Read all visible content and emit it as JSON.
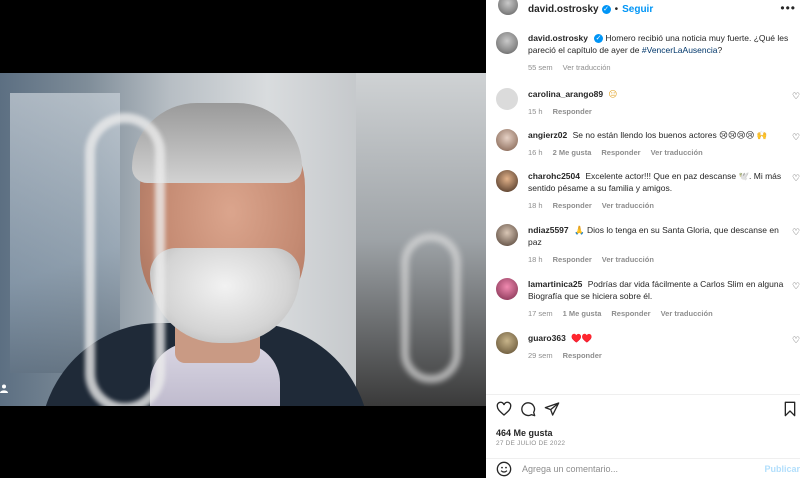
{
  "post": {
    "author": "david.ostrosky",
    "follow_label": "Seguir",
    "more_icon": "more-horizontal-icon"
  },
  "caption": {
    "username": "david.ostrosky",
    "text": "Homero recibió una noticia muy fuerte. ¿Qué les pareció el capítulo de ayer de ",
    "hashtag": "#VencerLaAusencia",
    "text_end": "?",
    "time": "55 sem",
    "see_translation": "Ver traducción"
  },
  "comments": [
    {
      "username": "carolina_arango89",
      "text": "😐",
      "time": "15 h",
      "likes": "",
      "reply": "Responder",
      "see_translation": ""
    },
    {
      "username": "angierz02",
      "text": "Se no están llendo los buenos actores 😢😢😢😢 🙌",
      "time": "16 h",
      "likes": "2 Me gusta",
      "reply": "Responder",
      "see_translation": "Ver traducción"
    },
    {
      "username": "charohc2504",
      "text": "Excelente actor!!! Que en paz descanse 🕊️. Mi más sentido pésame a su familia y amigos.",
      "time": "18 h",
      "likes": "",
      "reply": "Responder",
      "see_translation": "Ver traducción"
    },
    {
      "username": "ndiaz5597",
      "text": "🙏 Dios lo tenga en su Santa Gloria, que descanse en paz",
      "time": "18 h",
      "likes": "",
      "reply": "Responder",
      "see_translation": "Ver traducción"
    },
    {
      "username": "lamartinica25",
      "text": "Podrías dar vida fácilmente a Carlos Slim en alguna Biografía que se hiciera sobre él.",
      "time": "17 sem",
      "likes": "1 Me gusta",
      "reply": "Responder",
      "see_translation": "Ver traducción"
    },
    {
      "username": "guaro363",
      "text": "♥️♥️",
      "time": "29 sem",
      "likes": "",
      "reply": "Responder",
      "see_translation": ""
    }
  ],
  "stats": {
    "likes": "464 Me gusta",
    "date": "27 DE JULIO DE 2022"
  },
  "composer": {
    "placeholder": "Agrega un comentario...",
    "publish_label": "Publicar"
  },
  "colors": {
    "accent": "#0095f6",
    "muted": "#8e8e8e",
    "text": "#262626"
  }
}
